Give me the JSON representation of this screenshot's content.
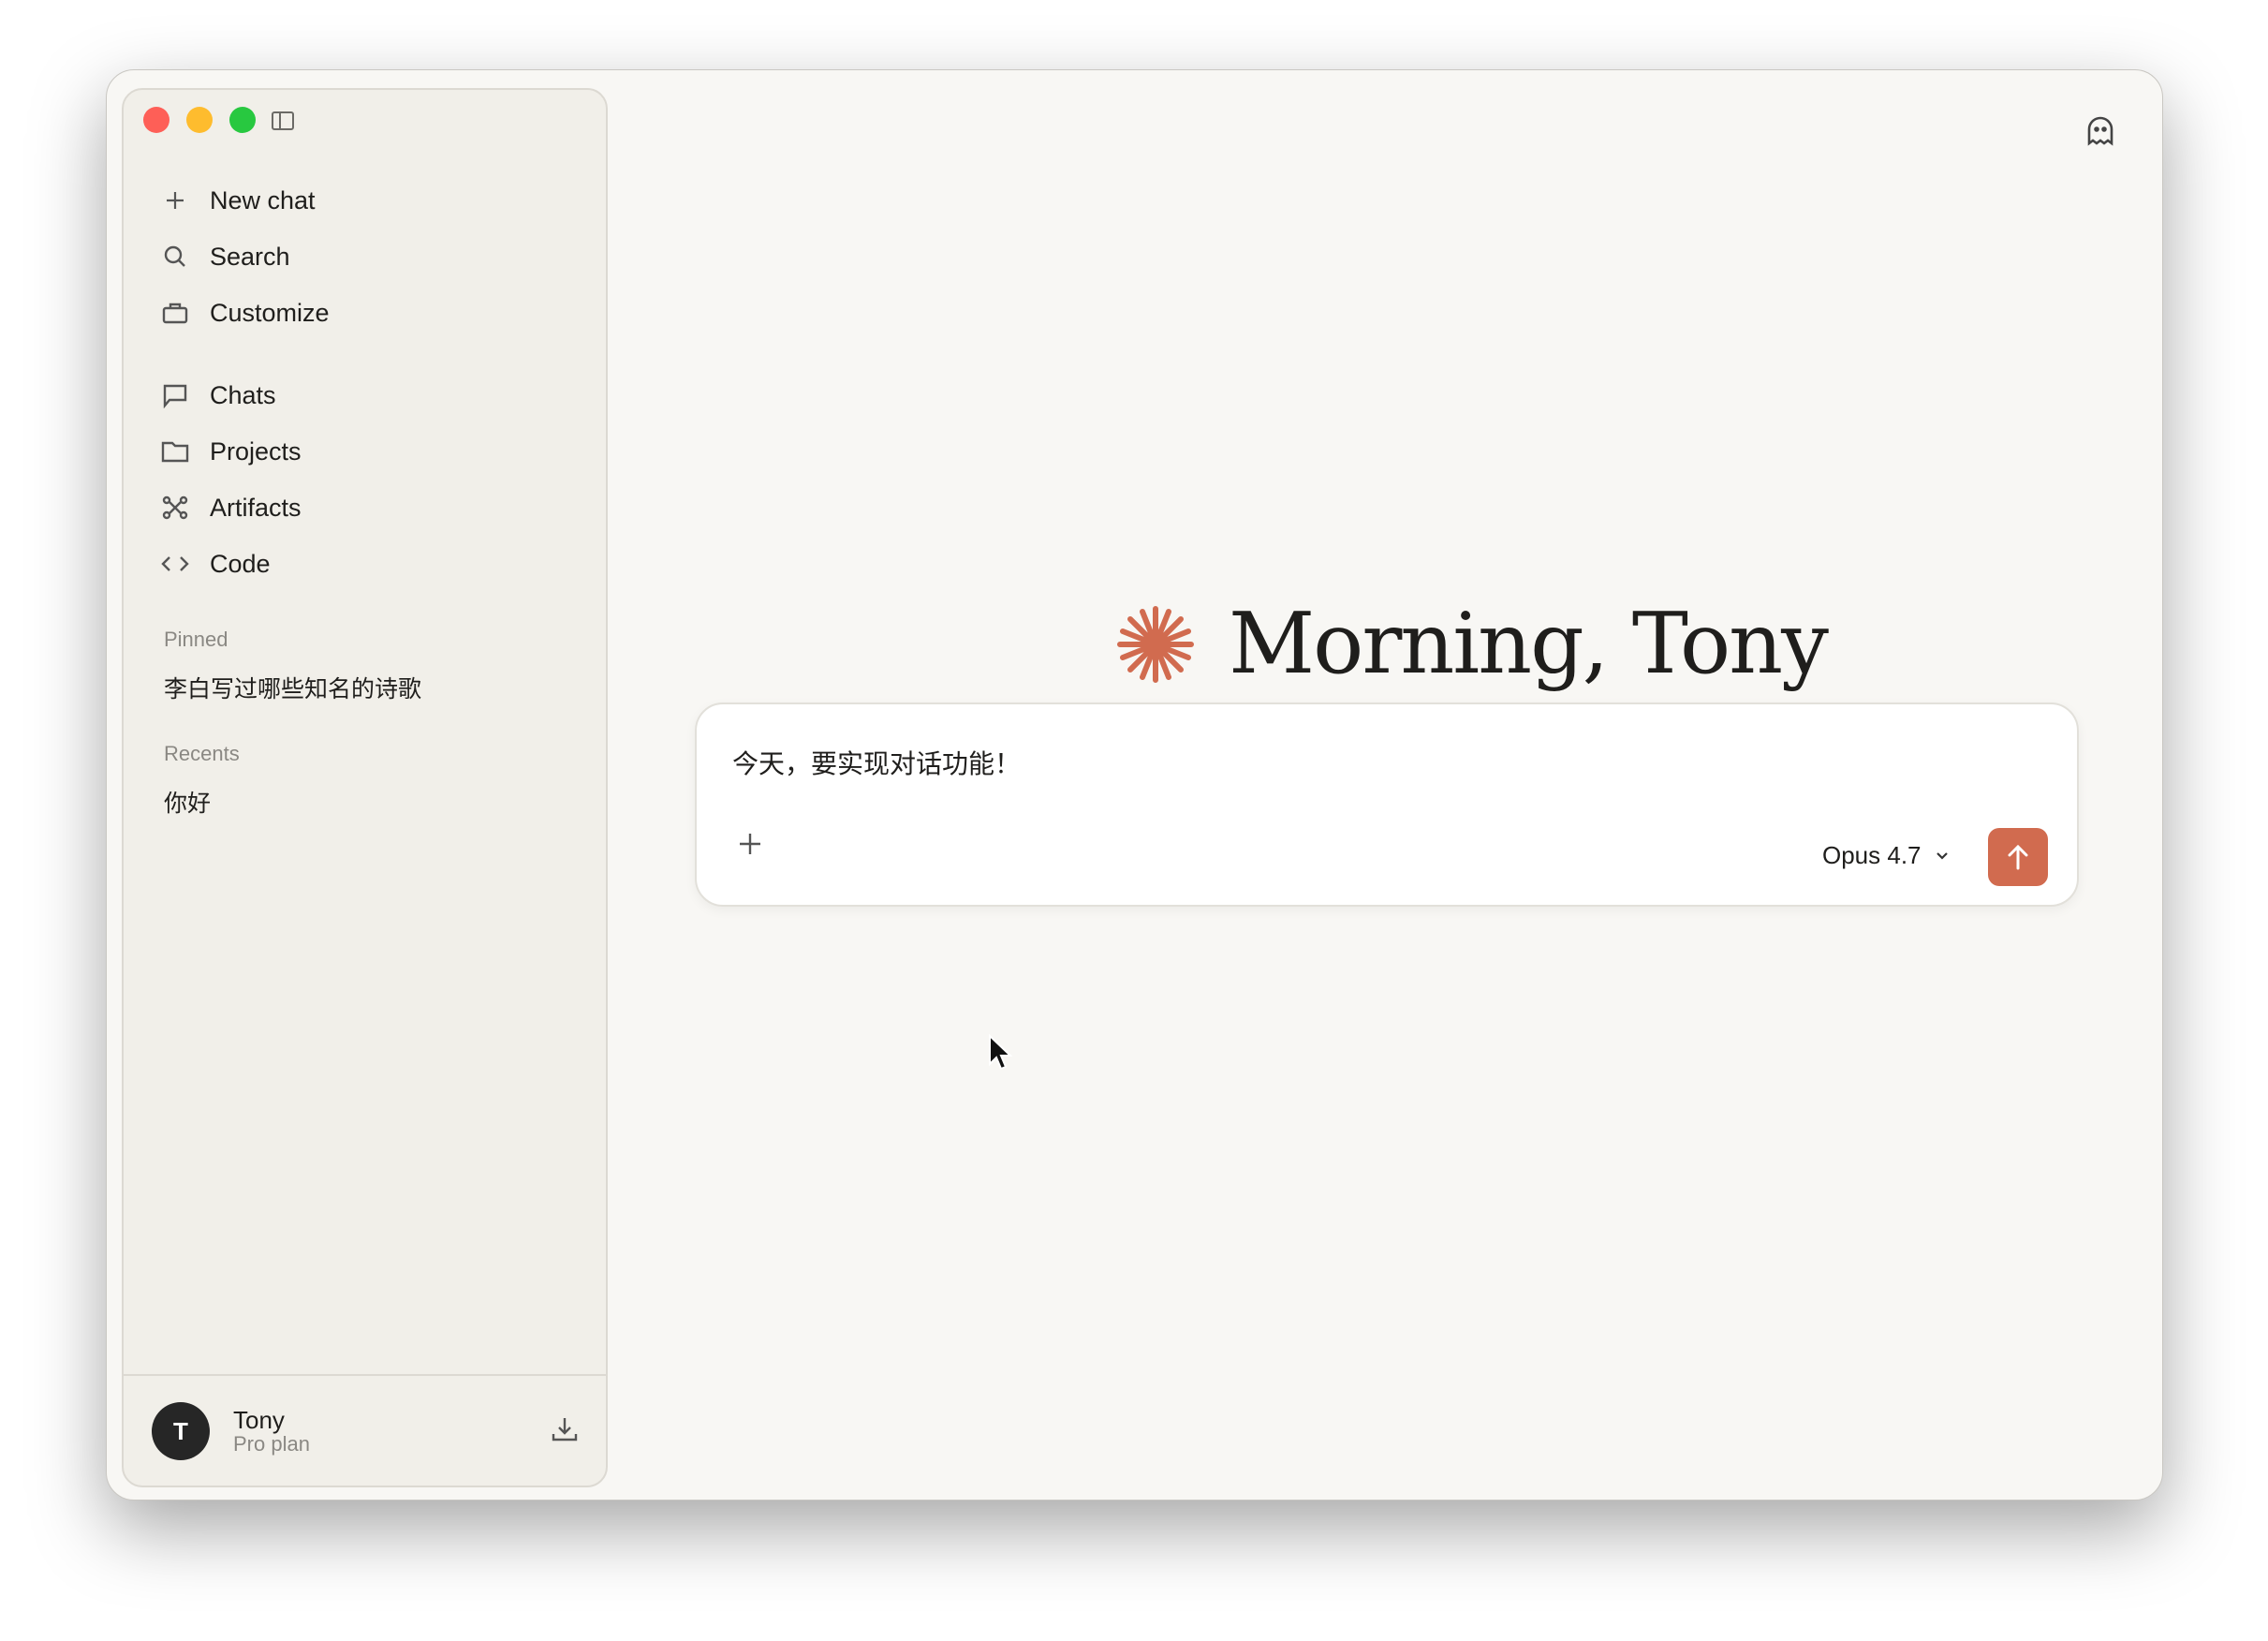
{
  "sidebar": {
    "nav": [
      {
        "label": "New chat",
        "icon": "plus-icon"
      },
      {
        "label": "Search",
        "icon": "search-icon"
      },
      {
        "label": "Customize",
        "icon": "briefcase-icon"
      },
      {
        "label": "Chats",
        "icon": "chat-bubble-icon"
      },
      {
        "label": "Projects",
        "icon": "folder-icon"
      },
      {
        "label": "Artifacts",
        "icon": "command-icon"
      },
      {
        "label": "Code",
        "icon": "code-icon"
      }
    ],
    "pinned_label": "Pinned",
    "pinned": [
      "李白写过哪些知名的诗歌"
    ],
    "recents_label": "Recents",
    "recents": [
      "你好"
    ],
    "user": {
      "initial": "T",
      "name": "Tony",
      "plan": "Pro plan"
    }
  },
  "main": {
    "greeting": "Morning, Tony",
    "input_value": "今天，要实现对话功能！",
    "model": "Opus 4.7"
  },
  "colors": {
    "accent": "#d16b4f",
    "sidebar_bg": "#f1efe9",
    "main_bg": "#f8f7f4"
  }
}
